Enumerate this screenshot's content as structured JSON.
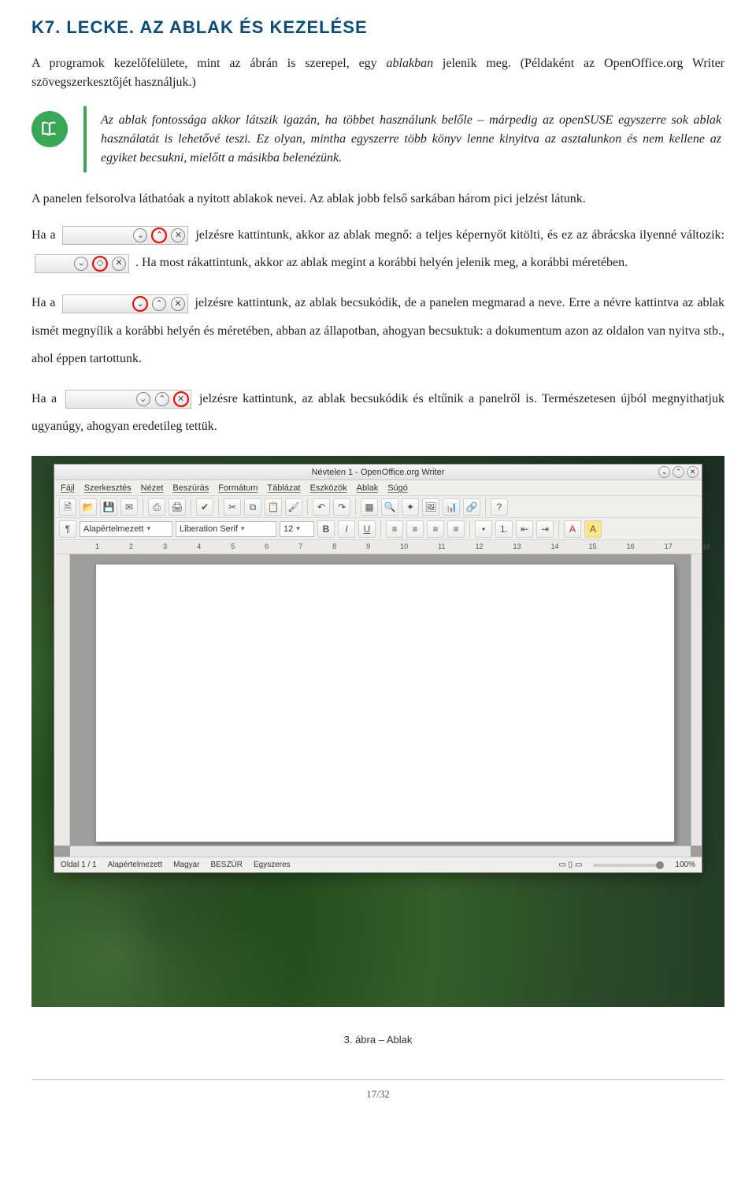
{
  "heading": "K7. LECKE. AZ ABLAK ÉS KEZELÉSE",
  "intro_before_italic": "A programok kezelőfelülete, mint az ábrán is szerepel, egy ",
  "intro_italic": "ablakban",
  "intro_after_italic": " jelenik meg. (Példaként az OpenOffice.org Writer szövegszerkesztőjét használjuk.)",
  "note": "Az ablak fontossága akkor látszik igazán, ha többet használunk belőle – márpedig az openSUSE egyszerre sok ablak használatát is lehetővé teszi. Ez olyan, mintha egyszerre több könyv lenne kinyitva az asztalunkon és nem kellene az egyiket becsukni, mielőtt a másikba belenézünk.",
  "para1": "A panelen felsorolva láthatóak a nyitott ablakok nevei. Az ablak jobb felső sarkában három pici jelzést látunk.",
  "p2a": "Ha a ",
  "p2b": " jelzésre kattintunk, akkor az ablak megnő: a teljes képernyőt kitölti, és ez az ábrácska ilyenné változik: ",
  "p2c": ". Ha most rákattintunk, akkor az ablak megint a korábbi helyén jelenik meg, a korábbi méretében.",
  "p3a": "Ha a ",
  "p3b": " jelzésre kattintunk, az ablak becsukódik, de a panelen megmarad a neve. Erre a névre kattintva az ablak ismét megnyílik a korábbi helyén és méretében, abban az állapotban, ahogyan becsuktuk: a dokumentum azon az oldalon van nyitva stb., ahol éppen tartottunk.",
  "p4a": "Ha a ",
  "p4b": " jelzésre kattintunk, az ablak becsukódik és eltűnik a panelről is. Természetesen újból megnyithatjuk ugyanúgy, ahogyan eredetileg tettük.",
  "app": {
    "title": "Névtelen 1 - OpenOffice.org Writer",
    "menus": [
      "Fájl",
      "Szerkesztés",
      "Nézet",
      "Beszúrás",
      "Formátum",
      "Táblázat",
      "Eszközök",
      "Ablak",
      "Súgó"
    ],
    "style": "Alapértelmezett",
    "font": "Liberation Serif",
    "size": "12",
    "ruler": [
      "1",
      "2",
      "3",
      "4",
      "5",
      "6",
      "7",
      "8",
      "9",
      "10",
      "11",
      "12",
      "13",
      "14",
      "15",
      "16",
      "17",
      "18"
    ],
    "status": {
      "page": "Oldal 1 / 1",
      "style": "Alapértelmezett",
      "lang": "Magyar",
      "ins": "BESZÚR",
      "sel": "Egyszeres",
      "zoom": "100%"
    }
  },
  "caption": "3. ábra – Ablak",
  "pagenum": "17/32",
  "glyph": {
    "min": "⌄",
    "max": "⌃",
    "restore": "◇",
    "close": "✕",
    "dd": "▾"
  }
}
